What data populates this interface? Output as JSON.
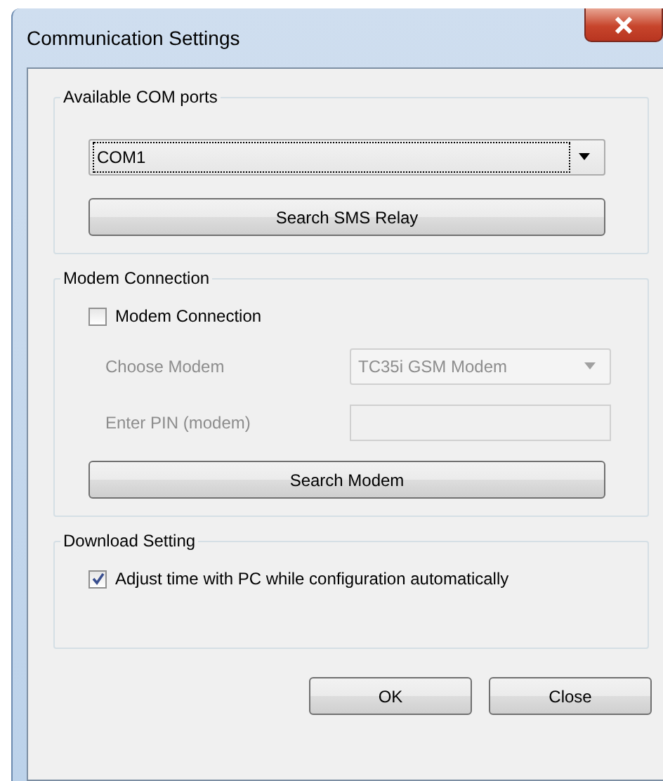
{
  "window": {
    "title": "Communication Settings"
  },
  "groups": [
    {
      "kind": "ports",
      "title": "Available COM ports",
      "combo": {
        "value": "COM1",
        "focused": true,
        "disabled": false
      },
      "button": "Search SMS Relay"
    },
    {
      "kind": "modem",
      "title": "Modem Connection",
      "checkbox": {
        "label": "Modem Connection",
        "checked": false
      },
      "fields": [
        {
          "kind": "combo",
          "label": "Choose Modem",
          "value": "TC35i GSM Modem",
          "disabled": true
        },
        {
          "kind": "text",
          "label": "Enter PIN (modem)",
          "disabled": true
        }
      ],
      "button": "Search Modem"
    },
    {
      "kind": "download",
      "title": "Download Setting",
      "checkbox": {
        "label": "Adjust time with PC while configuration automatically",
        "checked": true
      }
    }
  ],
  "buttons": [
    "OK",
    "Close"
  ]
}
